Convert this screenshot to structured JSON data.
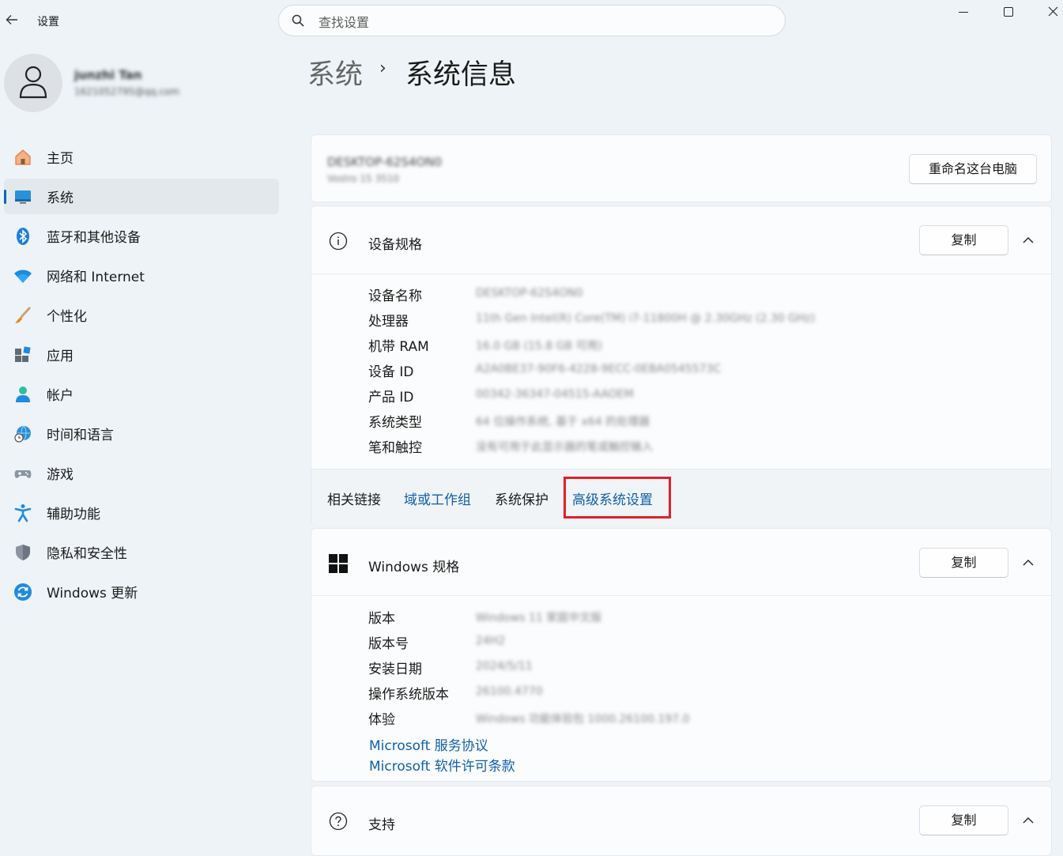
{
  "window": {
    "title": "设置",
    "search_placeholder": "查找设置"
  },
  "profile": {
    "name": "junzhi Tan",
    "email": "1621052795@qq.com"
  },
  "sidebar": {
    "items": [
      {
        "label": "主页",
        "icon": "home-icon"
      },
      {
        "label": "系统",
        "icon": "system-display-icon",
        "active": true
      },
      {
        "label": "蓝牙和其他设备",
        "icon": "bluetooth-icon"
      },
      {
        "label": "网络和 Internet",
        "icon": "wifi-icon"
      },
      {
        "label": "个性化",
        "icon": "paintbrush-icon"
      },
      {
        "label": "应用",
        "icon": "apps-icon"
      },
      {
        "label": "帐户",
        "icon": "account-icon"
      },
      {
        "label": "时间和语言",
        "icon": "globe-clock-icon"
      },
      {
        "label": "游戏",
        "icon": "gamepad-icon"
      },
      {
        "label": "辅助功能",
        "icon": "accessibility-icon"
      },
      {
        "label": "隐私和安全性",
        "icon": "shield-icon"
      },
      {
        "label": "Windows 更新",
        "icon": "windows-update-icon"
      }
    ]
  },
  "header": {
    "parent": "系统",
    "separator": "›",
    "current": "系统信息"
  },
  "pc_card": {
    "device_name": "DESKTOP-62S4ON0",
    "model": "Vostro 15 3510",
    "rename_button": "重命名这台电脑"
  },
  "device_specs": {
    "title": "设备规格",
    "copy_button": "复制",
    "rows": [
      {
        "label": "设备名称",
        "value": "DESKTOP-62S4ON0"
      },
      {
        "label": "处理器",
        "value": "11th Gen Intel(R) Core(TM) i7-11800H @ 2.30GHz (2.30 GHz)"
      },
      {
        "label": "机带 RAM",
        "value": "16.0 GB (15.8 GB 可用)"
      },
      {
        "label": "设备 ID",
        "value": "A2A0BE37-90F6-4228-9ECC-0EBA0545573C"
      },
      {
        "label": "产品 ID",
        "value": "00342-36347-04515-AAOEM"
      },
      {
        "label": "系统类型",
        "value": "64 位操作系统, 基于 x64 的处理器"
      },
      {
        "label": "笔和触控",
        "value": "没有可用于此显示器的笔或触控输入"
      }
    ]
  },
  "related_links": {
    "label": "相关链接",
    "links": [
      "域或工作组",
      "系统保护",
      "高级系统设置"
    ],
    "highlight_color": "#e3202a"
  },
  "windows_specs": {
    "title": "Windows 规格",
    "copy_button": "复制",
    "rows": [
      {
        "label": "版本",
        "value": "Windows 11 家庭中文版"
      },
      {
        "label": "版本号",
        "value": "24H2"
      },
      {
        "label": "安装日期",
        "value": "2024/5/11"
      },
      {
        "label": "操作系统版本",
        "value": "26100.4770"
      },
      {
        "label": "体验",
        "value": "Windows 功能体验包 1000.26100.197.0"
      }
    ],
    "links": [
      "Microsoft 服务协议",
      "Microsoft 软件许可条款"
    ]
  },
  "support": {
    "title": "支持",
    "copy_button": "复制"
  },
  "colors": {
    "accent": "#0067c0",
    "link": "#0f5fa8",
    "background": "#eef3f8"
  }
}
